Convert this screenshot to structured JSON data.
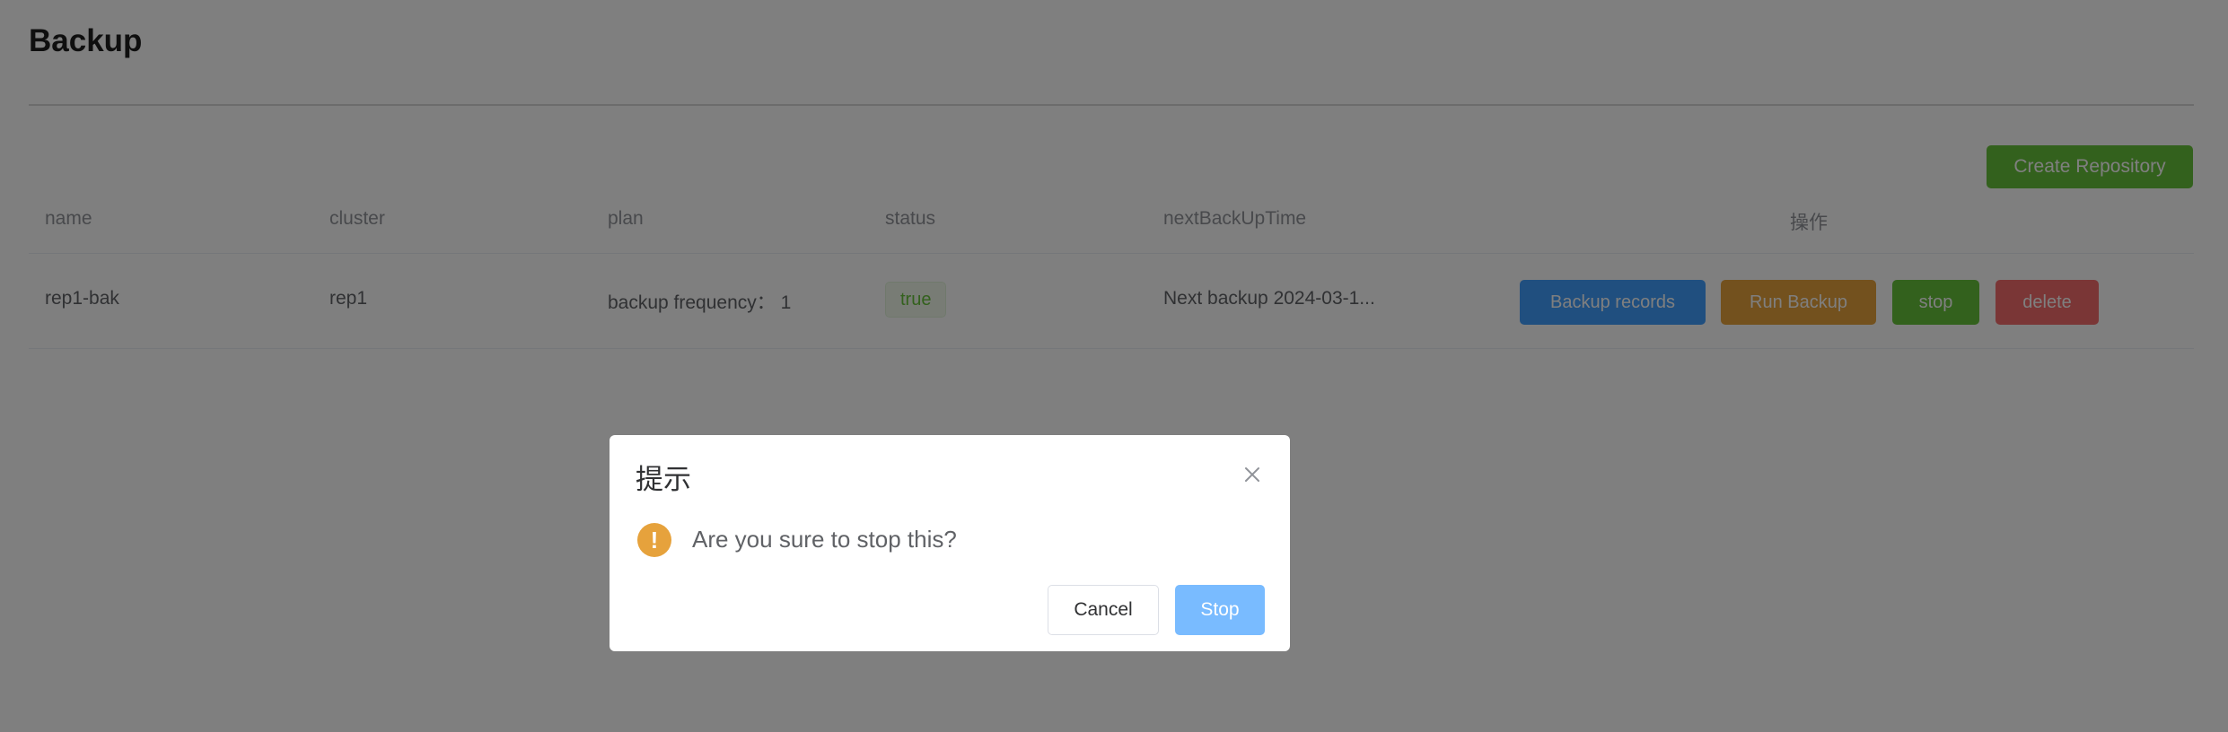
{
  "page": {
    "title": "Backup",
    "create_button": "Create Repository"
  },
  "table": {
    "headers": {
      "name": "name",
      "cluster": "cluster",
      "plan": "plan",
      "status": "status",
      "next": "nextBackUpTime",
      "actions": "操作"
    },
    "rows": [
      {
        "name": "rep1-bak",
        "cluster": "rep1",
        "plan": "backup frequency：  1",
        "status": "true",
        "next": "Next backup 2024-03-1...",
        "actions": {
          "records": "Backup records",
          "run": "Run Backup",
          "stop": "stop",
          "delete": "delete"
        }
      }
    ]
  },
  "dialog": {
    "title": "提示",
    "message": "Are you sure to stop this?",
    "cancel_label": "Cancel",
    "confirm_label": "Stop",
    "icon": "warning-icon"
  },
  "colors": {
    "primary": "#409eff",
    "success": "#67c23a",
    "warning": "#e6a23c",
    "danger": "#f56c6c",
    "confirm_disabled": "#79bbff"
  }
}
